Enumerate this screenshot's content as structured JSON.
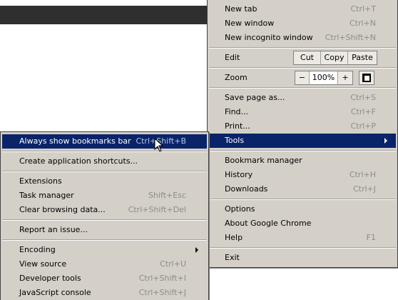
{
  "main_menu": {
    "new_tab": {
      "label": "New tab",
      "shortcut": "Ctrl+T"
    },
    "new_window": {
      "label": "New window",
      "shortcut": "Ctrl+N"
    },
    "new_incognito": {
      "label": "New incognito window",
      "shortcut": "Ctrl+Shift+N"
    },
    "edit": {
      "label": "Edit",
      "cut": "Cut",
      "copy": "Copy",
      "paste": "Paste"
    },
    "zoom": {
      "label": "Zoom",
      "minus": "−",
      "value": "100%",
      "plus": "+"
    },
    "save_page": {
      "label": "Save page as...",
      "shortcut": "Ctrl+S"
    },
    "find": {
      "label": "Find...",
      "shortcut": "Ctrl+F"
    },
    "print": {
      "label": "Print...",
      "shortcut": "Ctrl+P"
    },
    "tools": {
      "label": "Tools"
    },
    "bookmark_manager": {
      "label": "Bookmark manager"
    },
    "history": {
      "label": "History",
      "shortcut": "Ctrl+H"
    },
    "downloads": {
      "label": "Downloads",
      "shortcut": "Ctrl+J"
    },
    "options": {
      "label": "Options"
    },
    "about": {
      "label": "About Google Chrome"
    },
    "help": {
      "label": "Help",
      "shortcut": "F1"
    },
    "exit": {
      "label": "Exit"
    }
  },
  "tools_menu": {
    "bookmarks_bar": {
      "label": "Always show bookmarks bar",
      "shortcut": "Ctrl+Shift+B"
    },
    "app_shortcuts": {
      "label": "Create application shortcuts..."
    },
    "extensions": {
      "label": "Extensions"
    },
    "task_manager": {
      "label": "Task manager",
      "shortcut": "Shift+Esc"
    },
    "clear_data": {
      "label": "Clear browsing data...",
      "shortcut": "Ctrl+Shift+Del"
    },
    "report_issue": {
      "label": "Report an issue..."
    },
    "encoding": {
      "label": "Encoding"
    },
    "view_source": {
      "label": "View source",
      "shortcut": "Ctrl+U"
    },
    "developer_tools": {
      "label": "Developer tools",
      "shortcut": "Ctrl+Shift+I"
    },
    "js_console": {
      "label": "JavaScript console",
      "shortcut": "Ctrl+Shift+J"
    }
  },
  "colors": {
    "menu_bg": "#d4d0c8",
    "highlight": "#0a246a",
    "shortcut_text": "#8c8c8c"
  }
}
